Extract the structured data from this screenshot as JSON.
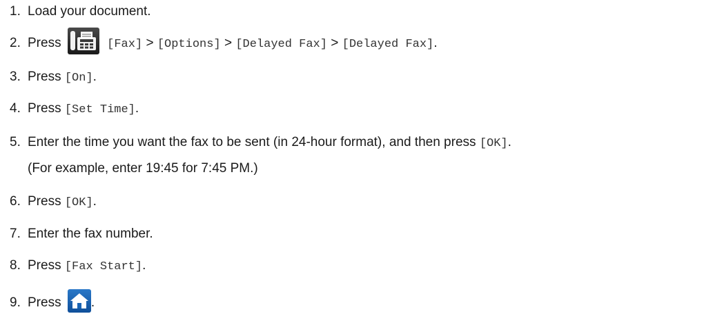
{
  "steps": [
    {
      "num": "1.",
      "parts": [
        "Load your document."
      ]
    },
    {
      "num": "2.",
      "parts": [
        "Press",
        "[Fax]",
        ">",
        "[Options]",
        ">",
        "[Delayed Fax]",
        ">",
        "[Delayed Fax]",
        "."
      ]
    },
    {
      "num": "3.",
      "parts": [
        "Press",
        "[On]",
        "."
      ]
    },
    {
      "num": "4.",
      "parts": [
        "Press",
        "[Set Time]",
        "."
      ]
    },
    {
      "num": "5.",
      "parts": [
        "Enter the time you want the fax to be sent (in 24-hour format), and then press",
        "[OK]",
        "."
      ],
      "continuation": "(For example, enter 19:45 for 7:45 PM.)"
    },
    {
      "num": "6.",
      "parts": [
        "Press",
        "[OK]",
        "."
      ]
    },
    {
      "num": "7.",
      "parts": [
        "Enter the fax number."
      ]
    },
    {
      "num": "8.",
      "parts": [
        "Press",
        "[Fax Start]",
        "."
      ]
    },
    {
      "num": "9.",
      "parts": [
        "Press",
        "."
      ]
    }
  ],
  "icons": {
    "fax": "fax-icon",
    "home": "home-icon"
  },
  "colors": {
    "text": "#1a1a1a",
    "fax_icon_bg": "#2a2a2a",
    "home_icon_bg": "#1a64b4"
  }
}
